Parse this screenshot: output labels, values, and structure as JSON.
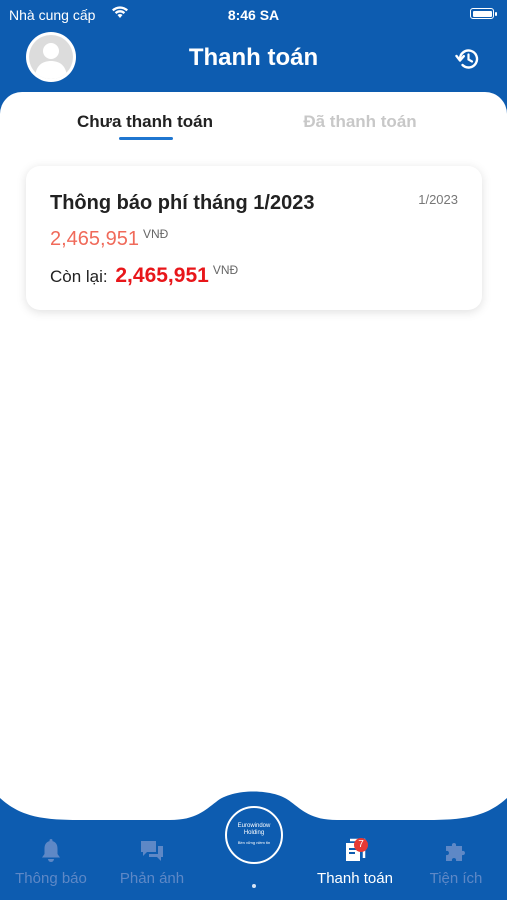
{
  "status_bar": {
    "carrier": "Nhà cung cấp",
    "time": "8:46 SA"
  },
  "header": {
    "title": "Thanh toán"
  },
  "tabs": [
    {
      "label": "Chưa thanh toán",
      "active": true
    },
    {
      "label": "Đã thanh toán",
      "active": false
    }
  ],
  "bills": [
    {
      "title": "Thông báo phí tháng 1/2023",
      "period": "1/2023",
      "amount": "2,465,951",
      "currency": "VNĐ",
      "remaining_label": "Còn lại:",
      "remaining_amount": "2,465,951",
      "remaining_currency": "VNĐ"
    }
  ],
  "bottom_nav": {
    "items": [
      {
        "label": "Thông báo",
        "icon": "bell-icon",
        "active": false
      },
      {
        "label": "Phản ánh",
        "icon": "chat-bubbles-icon",
        "active": false
      },
      {
        "label": "Thanh toán",
        "icon": "receipt-icon",
        "active": true,
        "badge": "7"
      },
      {
        "label": "Tiện ích",
        "icon": "puzzle-icon",
        "active": false
      }
    ],
    "center_logo": {
      "line1": "Eurowindow Holding",
      "line2": "Bền vững niềm tin"
    }
  },
  "colors": {
    "brand_blue": "#0d5cb0",
    "amount_salmon": "#f06a5a",
    "remaining_red": "#e8161a",
    "inactive_nav": "#5e88c6"
  }
}
